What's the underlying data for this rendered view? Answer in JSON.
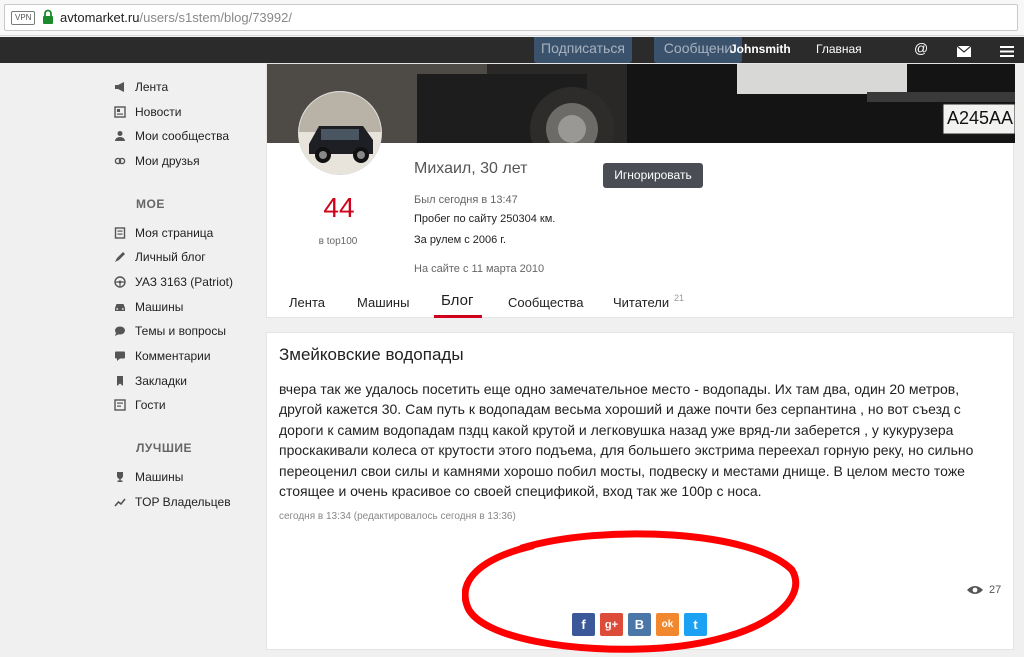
{
  "browser": {
    "vpn_label": "VPN",
    "url_domain": "avtomarket.ru",
    "url_path": "/users/s1stem/blog/73992/"
  },
  "topnav": {
    "ghost_subscribe": "Подписаться",
    "ghost_message": "Сообщени",
    "username": "Johnsmith",
    "home": "Главная",
    "icons": [
      "at-icon",
      "mail-icon",
      "menu-icon"
    ]
  },
  "sidebar": {
    "main_items": [
      {
        "label": "Лента",
        "icon": "megaphone-icon"
      },
      {
        "label": "Новости",
        "icon": "news-icon"
      },
      {
        "label": "Мои сообщества",
        "icon": "community-icon"
      },
      {
        "label": "Мои друзья",
        "icon": "friends-icon"
      }
    ],
    "section_mine": "МОЕ",
    "mine_items": [
      {
        "label": "Моя страница",
        "icon": "page-icon"
      },
      {
        "label": "Личный блог",
        "icon": "pen-icon"
      },
      {
        "label": "УАЗ 3163 (Patriot)",
        "icon": "steering-wheel-icon"
      },
      {
        "label": "Машины",
        "icon": "car-icon"
      },
      {
        "label": "Темы и вопросы",
        "icon": "chat-icon"
      },
      {
        "label": "Комментарии",
        "icon": "comment-icon"
      },
      {
        "label": "Закладки",
        "icon": "bookmark-icon"
      },
      {
        "label": "Гости",
        "icon": "guests-icon"
      }
    ],
    "section_best": "ЛУЧШИЕ",
    "best_items": [
      {
        "label": "Машины",
        "icon": "trophy-icon"
      },
      {
        "label": "TOP Владельцев",
        "icon": "trend-icon"
      }
    ]
  },
  "profile": {
    "rating": "44",
    "rating_label": "в top100",
    "name": "Михаил, 30 лет",
    "last_seen": "Был сегодня в 13:47",
    "mileage": "Пробег по сайту 250304 км.",
    "driving_since": "За рулем с 2006 г.",
    "registered": "На сайте с 11 марта 2010",
    "ignore_button": "Игнорировать",
    "plate": "А245АА",
    "tabs": [
      "Лента",
      "Машины",
      "Блог",
      "Сообщества",
      "Читатели"
    ],
    "active_tab": "Блог",
    "readers_count": "21"
  },
  "post": {
    "title": "Змейковские водопады",
    "body": "вчера так же удалось посетить еще одно замечательное место - водопады. Их там два, один 20 метров, другой кажется 30. Сам путь к водопадам весьма хороший и даже почти без серпантина , но вот съезд с дороги к самим водопадам пздц какой крутой и легковушка назад уже вряд-ли заберется , у кукурузера проскакивали колеса от крутости этого подъема, для большего экстрима переехал горную реку, но сильно переоценил свои силы и камнями хорошо побил мосты, подвеску и местами днище. В целом место тоже стоящее и очень красивое со своей спецификой, вход так же 100р с носа.",
    "meta": "сегодня в 13:34 (редактировалось сегодня в 13:36)",
    "views": "27",
    "share": [
      {
        "label": "f",
        "icon": "facebook-icon",
        "color": "#3b5998"
      },
      {
        "label": "g+",
        "icon": "google-plus-icon",
        "color": "#dd4b39"
      },
      {
        "label": "B",
        "icon": "vkontakte-icon",
        "color": "#4a76a8"
      },
      {
        "label": "ok",
        "icon": "odnoklassniki-icon",
        "color": "#f2882d"
      },
      {
        "label": "t",
        "icon": "twitter-icon",
        "color": "#1da1f2"
      }
    ]
  },
  "colors": {
    "accent_red": "#d0021b",
    "annotation_red": "#ff0000",
    "nav_dark": "#2b2b2b",
    "button_dark": "#4a4e54"
  }
}
